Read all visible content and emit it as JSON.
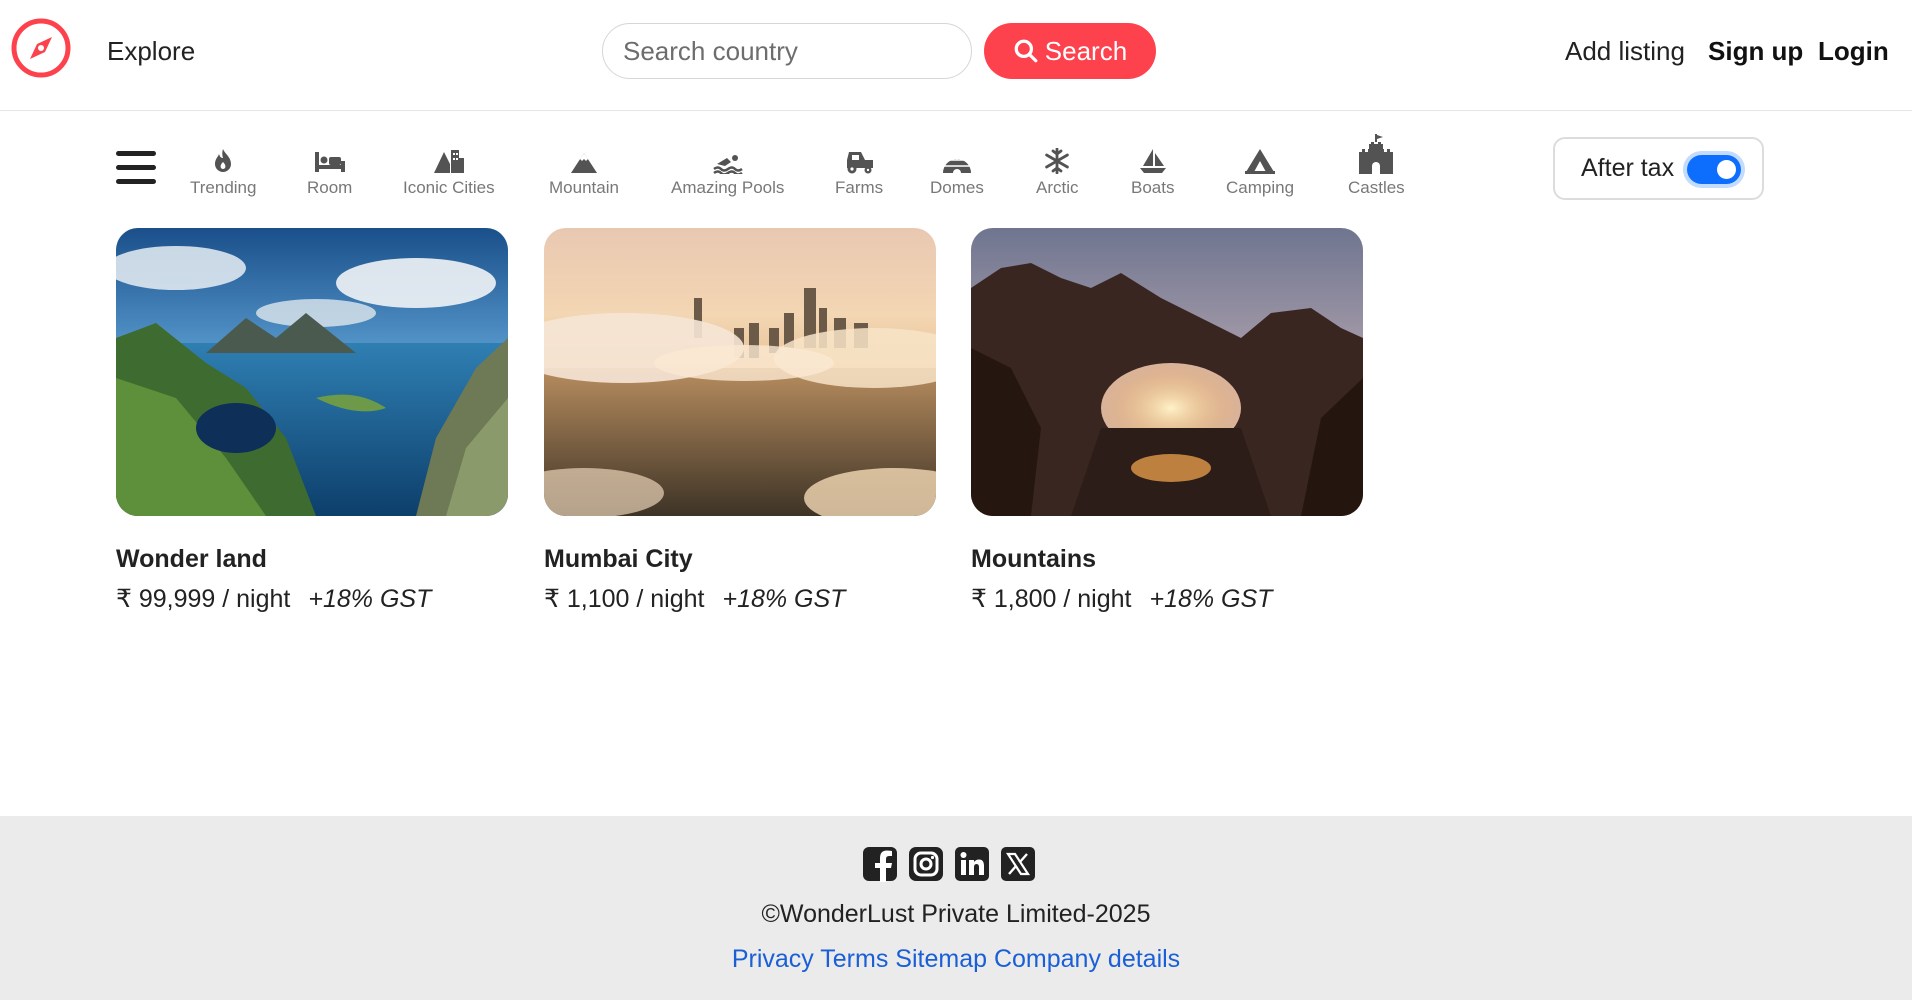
{
  "navbar": {
    "brand_icon": "compass-icon",
    "brand_color": "#fe424d",
    "explore_label": "Explore",
    "search": {
      "placeholder": "Search country",
      "value": "",
      "button_label": "Search",
      "button_icon": "magnifier-icon"
    },
    "add_listing_label": "Add listing",
    "signup_label": "Sign up",
    "login_label": "Login"
  },
  "filters": {
    "menu_icon": "hamburger-icon",
    "items": [
      {
        "label": "Trending",
        "icon": "fire-icon"
      },
      {
        "label": "Room",
        "icon": "bed-icon"
      },
      {
        "label": "Iconic Cities",
        "icon": "mountain-city-icon"
      },
      {
        "label": "Mountain",
        "icon": "mountain-icon"
      },
      {
        "label": "Amazing Pools",
        "icon": "person-swimming-icon"
      },
      {
        "label": "Farms",
        "icon": "tractor-icon"
      },
      {
        "label": "Domes",
        "icon": "igloo-icon"
      },
      {
        "label": "Arctic",
        "icon": "snowflake-icon"
      },
      {
        "label": "Boats",
        "icon": "sailboat-icon"
      },
      {
        "label": "Camping",
        "icon": "campground-icon"
      },
      {
        "label": "Castles",
        "icon": "castle-icon"
      }
    ],
    "tax_toggle": {
      "label": "After tax",
      "on": true,
      "accent": "#0d6efd"
    }
  },
  "listings": [
    {
      "title": "Wonder land",
      "price": "₹ 99,999 / night",
      "gst": "+18% GST",
      "image": "coastal-fjord-landscape"
    },
    {
      "title": "Mumbai City",
      "price": "₹ 1,100 / night",
      "gst": "+18% GST",
      "image": "foggy-city-sunrise"
    },
    {
      "title": "Mountains",
      "price": "₹ 1,800 / night",
      "gst": "+18% GST",
      "image": "desert-rock-arch"
    }
  ],
  "footer": {
    "socials": [
      "facebook-icon",
      "instagram-icon",
      "linkedin-icon",
      "x-icon"
    ],
    "copyright": "©WonderLust Private Limited-2025",
    "links": [
      "Privacy",
      "Terms",
      "Sitemap",
      "Company details"
    ],
    "link_color": "#1a5fd6"
  }
}
